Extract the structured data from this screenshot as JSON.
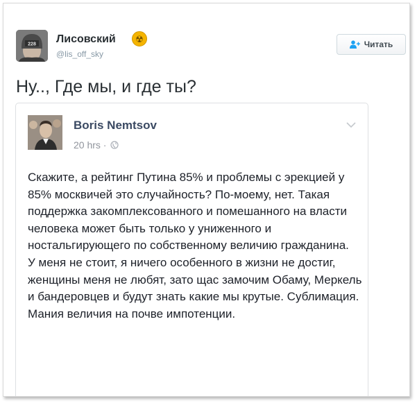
{
  "tweet": {
    "author": {
      "name": "Лисовский",
      "handle": "@lis_off_sky",
      "badge_icon": "radiation-icon",
      "avatar_icon": "person-cap-icon",
      "avatar_text": "228"
    },
    "follow_button": {
      "label": "Читать",
      "icon": "add-user-icon"
    },
    "text": "Ну.., Где мы, и где ты?"
  },
  "embedded_post": {
    "author_name": "Boris Nemtsov",
    "timestamp": "20 hrs ·",
    "privacy_icon": "globe-icon",
    "menu_icon": "chevron-down-icon",
    "paragraphs": [
      "Скажите, а рейтинг Путина 85% и проблемы с эрекцией у 85% москвичей это случайность? По-моему, нет. Такая поддержка закомплексованного и помешанного на власти человека может быть только у униженного и ностальгирующего по собственному величию гражданина.",
      "У меня не стоит, я ничего особенного в жизни не достиг, женщины меня не любят, зато щас замочим Обаму, Меркель и бандеровцев и будут знать какие мы крутые. Сублимация. Мания величия на почве импотенции."
    ]
  },
  "colors": {
    "text": "#292f33",
    "handle": "#8899a6",
    "fb_name": "#3b4a63",
    "fb_meta": "#90949c",
    "accent": "#1da1f2"
  }
}
